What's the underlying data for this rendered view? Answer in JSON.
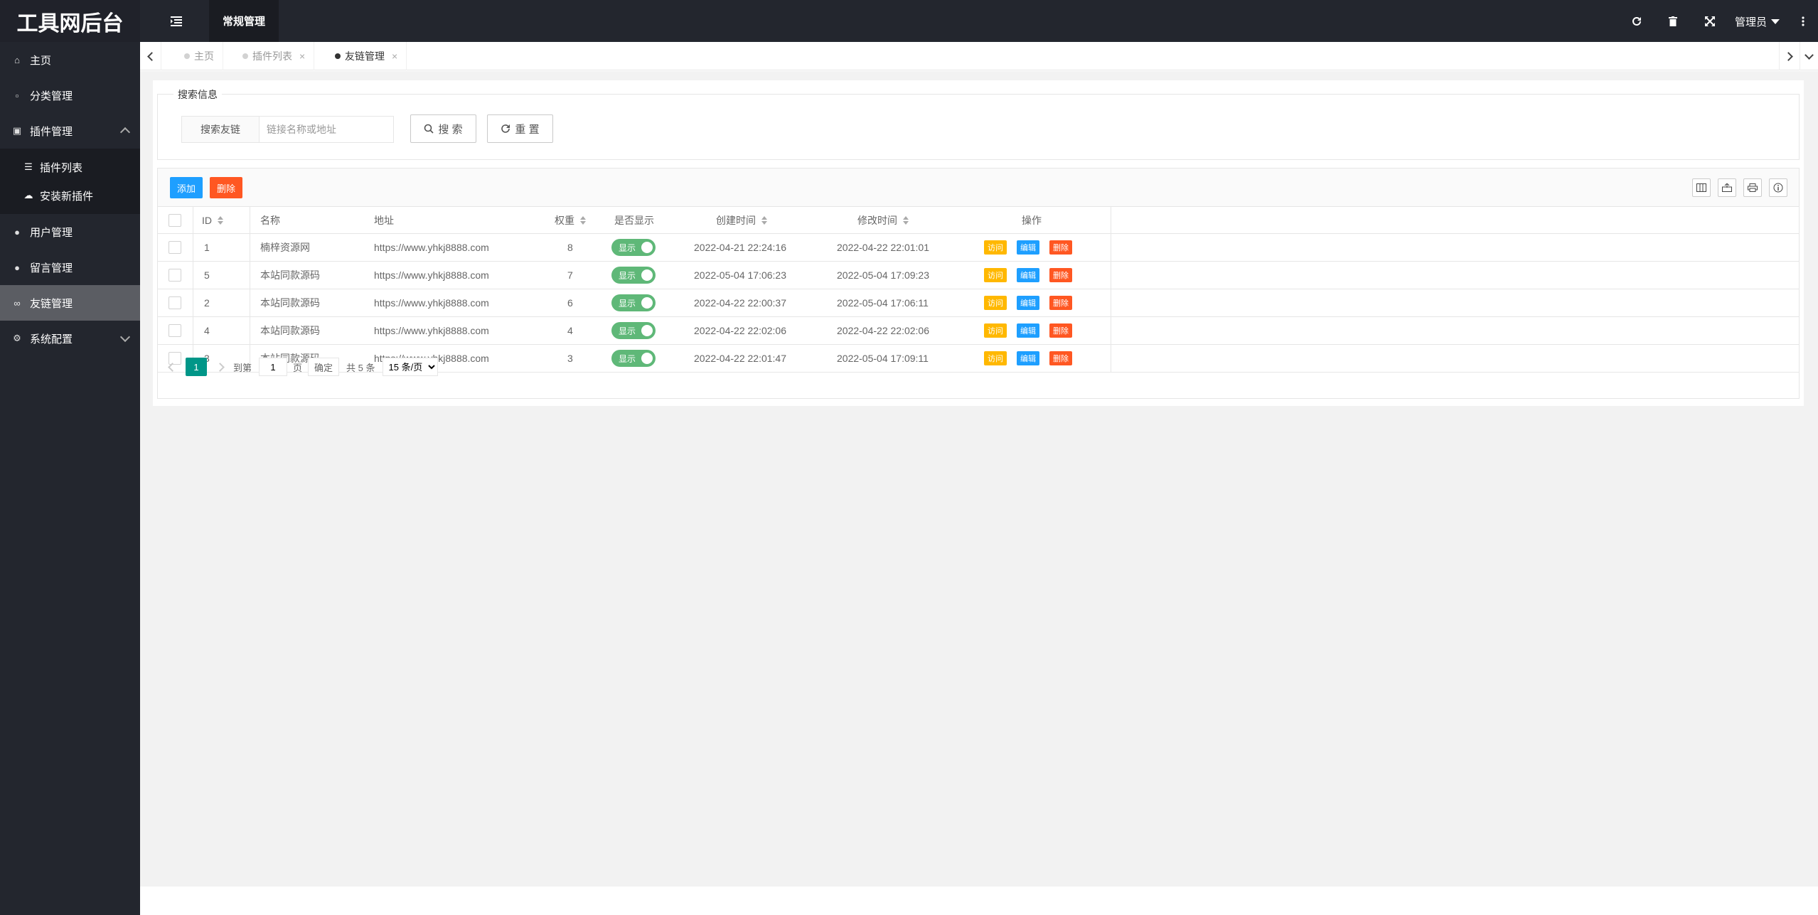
{
  "app": {
    "title": "工具网后台"
  },
  "header": {
    "top_tab": "常规管理",
    "user_label": "管理员",
    "icons": [
      "menu-toggle-icon",
      "refresh-icon",
      "trash-icon",
      "fullscreen-icon",
      "more-vertical-icon"
    ]
  },
  "sidebar": {
    "items": [
      {
        "label": "主页",
        "icon": "home-icon"
      },
      {
        "label": "分类管理",
        "icon": "bookmark-icon"
      },
      {
        "label": "插件管理",
        "icon": "puzzle-icon"
      },
      {
        "label": "用户管理",
        "icon": "user-icon"
      },
      {
        "label": "留言管理",
        "icon": "chat-icon"
      },
      {
        "label": "友链管理",
        "icon": "link-icon"
      },
      {
        "label": "系统配置",
        "icon": "gears-icon"
      }
    ],
    "sub_items": [
      {
        "label": "插件列表",
        "icon": "list-icon"
      },
      {
        "label": "安装新插件",
        "icon": "cloud-download-icon"
      }
    ]
  },
  "tabs": [
    {
      "label": "主页"
    },
    {
      "label": "插件列表"
    },
    {
      "label": "友链管理"
    }
  ],
  "search": {
    "legend": "搜索信息",
    "field_label": "搜索友链",
    "placeholder": "链接名称或地址",
    "search_button": "搜 索",
    "reset_button": "重 置"
  },
  "toolbar": {
    "add_label": "添加",
    "delete_label": "删除",
    "icons": [
      "columns-icon",
      "export-icon",
      "print-icon",
      "info-icon"
    ]
  },
  "table": {
    "columns": [
      "ID",
      "名称",
      "地址",
      "权重",
      "是否显示",
      "创建时间",
      "修改时间",
      "操作"
    ],
    "switch_label": "显示",
    "actions": {
      "visit": "访问",
      "edit": "编辑",
      "delete": "删除"
    },
    "rows": [
      {
        "id": "1",
        "name": "楠梓资源网",
        "url": "https://www.yhkj8888.com",
        "weight": "8",
        "created": "2022-04-21 22:24:16",
        "modified": "2022-04-22 22:01:01"
      },
      {
        "id": "5",
        "name": "本站同款源码",
        "url": "https://www.yhkj8888.com",
        "weight": "7",
        "created": "2022-05-04 17:06:23",
        "modified": "2022-05-04 17:09:23"
      },
      {
        "id": "2",
        "name": "本站同款源码",
        "url": "https://www.yhkj8888.com",
        "weight": "6",
        "created": "2022-04-22 22:00:37",
        "modified": "2022-05-04 17:06:11"
      },
      {
        "id": "4",
        "name": "本站同款源码",
        "url": "https://www.yhkj8888.com",
        "weight": "4",
        "created": "2022-04-22 22:02:06",
        "modified": "2022-04-22 22:02:06"
      },
      {
        "id": "3",
        "name": "本站同款源码",
        "url": "https://www.yhkj8888.com",
        "weight": "3",
        "created": "2022-04-22 22:01:47",
        "modified": "2022-05-04 17:09:11"
      }
    ]
  },
  "pager": {
    "current": "1",
    "goto_label": "到第",
    "page_input": "1",
    "page_unit": "页",
    "confirm": "确定",
    "total": "共 5 条",
    "page_size": "15 条/页"
  }
}
